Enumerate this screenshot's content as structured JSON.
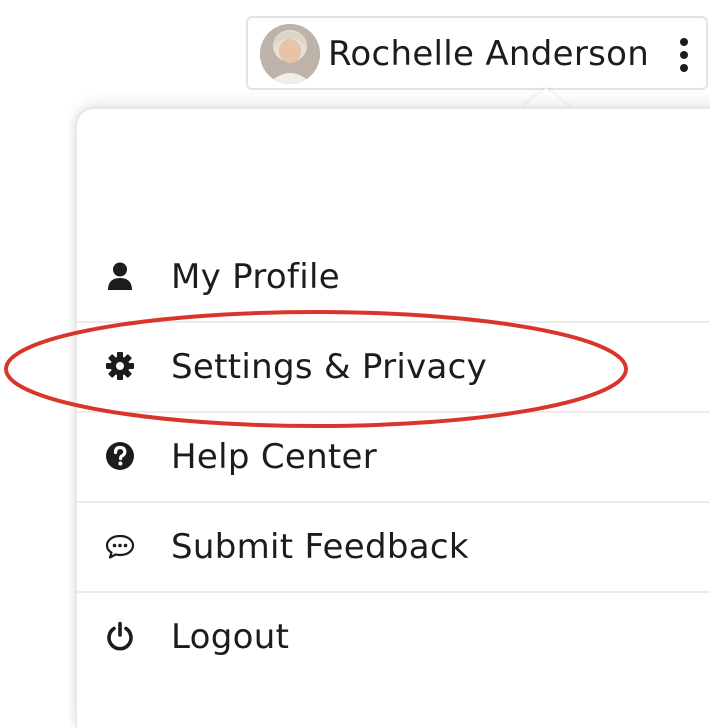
{
  "account": {
    "name": "Rochelle Anderson",
    "avatar_icon": "user-photo-avatar",
    "more_icon": "kebab-vertical-icon"
  },
  "menu": {
    "items": [
      {
        "label": "My Profile",
        "icon": "user-icon"
      },
      {
        "label": "Settings & Privacy",
        "icon": "gear-icon"
      },
      {
        "label": "Help Center",
        "icon": "question-circle-icon"
      },
      {
        "label": "Submit Feedback",
        "icon": "chat-bubble-icon"
      },
      {
        "label": "Logout",
        "icon": "power-icon"
      }
    ]
  },
  "annotation": {
    "highlight_color": "#d9362b",
    "highlighted_item": "Settings & Privacy"
  }
}
